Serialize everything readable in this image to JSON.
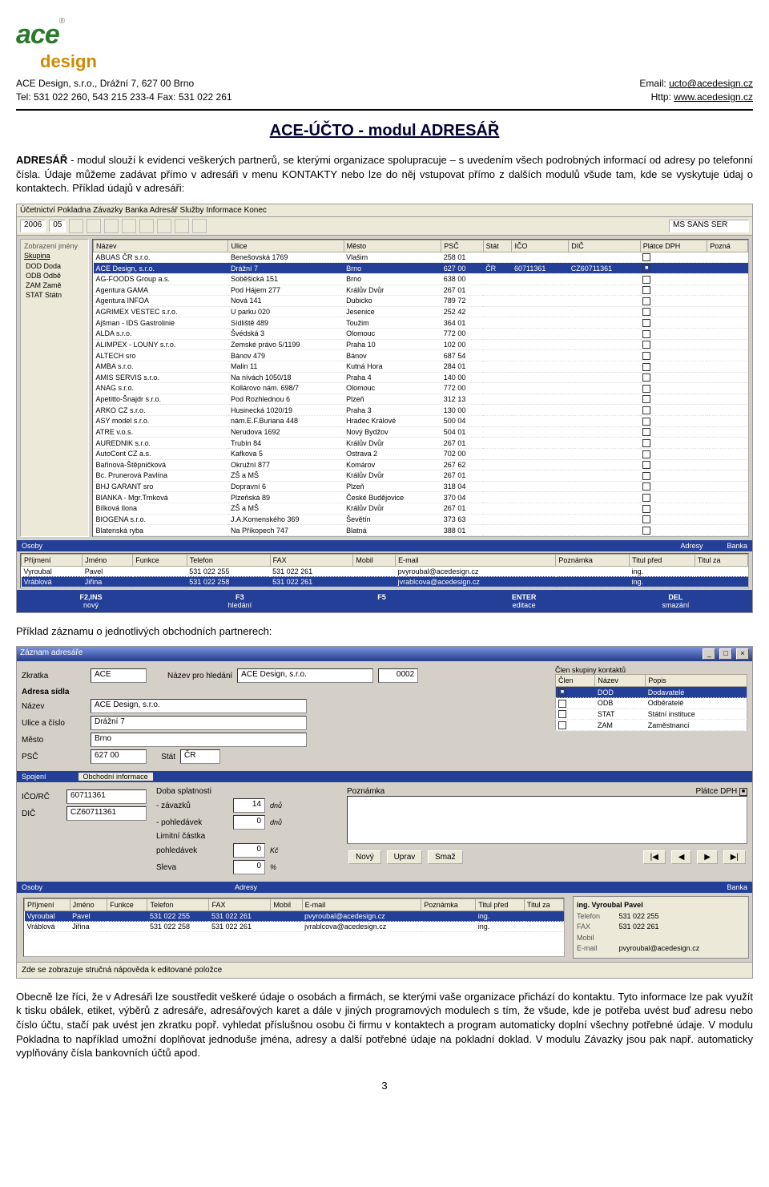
{
  "header": {
    "company": "ACE Design, s.r.o., Drážní 7, 627 00 Brno",
    "phone": "Tel: 531 022 260, 543 215 233-4   Fax: 531 022 261",
    "email_label": "Email: ",
    "email": "ucto@acedesign.cz",
    "web_label": "Http: ",
    "web": "www.acedesign.cz",
    "logo_text": "ace",
    "logo_sub": "design"
  },
  "title": "ACE-ÚČTO - modul ADRESÁŘ",
  "intro_bold": "ADRESÁŘ",
  "intro": " - modul slouží k evidenci veškerých partnerů, se kterými organizace spolupracuje – s uvedením všech podrobných informací od adresy po telefonní čísla. Údaje můžeme zadávat přímo v adresáři v menu KONTAKTY nebo lze do něj vstupovat přímo z dalších modulů všude tam, kde se vyskytuje údaj o kontaktech. Příklad údajů v adresáři:",
  "caption2": "Příklad záznamu o jednotlivých obchodních partnerech:",
  "outro": "Obecně lze říci, že v Adresáři lze soustředit veškeré údaje o osobách a firmách, se kterými vaše organizace přichází do kontaktu. Tyto informace lze pak využít k tisku obálek, etiket, výběrů z adresáře, adresářových karet a dále v jiných programových modulech s tím, že všude, kde je potřeba uvést buď adresu nebo číslo účtu, stačí pak uvést jen zkratku popř. vyhledat příslušnou osobu či firmu v kontaktech a program automaticky doplní všechny potřebné údaje. V modulu Pokladna to například umožní doplňovat jednoduše jména, adresy a další potřebné údaje na pokladní doklad. V modulu Závazky jsou pak např. automaticky vyplňovány čísla bankovních účtů apod.",
  "page_number": "3",
  "window1": {
    "title": "Účetnictví  Pokladna  Závazky  Banka  Adresář  Služby  Informace  Konec",
    "toolbar_year": "2006",
    "toolbar_month": "05",
    "font_label": "MS SANS SER",
    "sidebar_groups_header": "Skupina",
    "sidebar_groups": [
      {
        "code": "DOD",
        "desc": "Doda"
      },
      {
        "code": "ODB",
        "desc": "Odbě"
      },
      {
        "code": "ZAM",
        "desc": "Zamě"
      },
      {
        "code": "STAT",
        "desc": "Státn"
      }
    ],
    "zobrazeni": "Zobrazení jmény",
    "columns": [
      "Název",
      "Ulice",
      "Město",
      "PSČ",
      "Stát",
      "IČO",
      "DIČ",
      "Plátce DPH",
      "Pozná"
    ],
    "rows": [
      {
        "nazev": "ABUAS ČR s.r.o.",
        "ulice": "Benešovská 1769",
        "mesto": "Vlašim",
        "psc": "258 01",
        "stat": "",
        "ico": "",
        "dic": "",
        "dph": false,
        "sel": false
      },
      {
        "nazev": "ACE Design, s.r.o.",
        "ulice": "Drážní 7",
        "mesto": "Brno",
        "psc": "627 00",
        "stat": "ČR",
        "ico": "60711361",
        "dic": "CZ60711361",
        "dph": true,
        "sel": true
      },
      {
        "nazev": "AG-FOODS Group a.s.",
        "ulice": "Soběšická 151",
        "mesto": "Brno",
        "psc": "638 00",
        "stat": "",
        "ico": "",
        "dic": "",
        "dph": false,
        "sel": false
      },
      {
        "nazev": "Agentura GAMA",
        "ulice": "Pod Hájem 277",
        "mesto": "Králův Dvůr",
        "psc": "267 01",
        "stat": "",
        "ico": "",
        "dic": "",
        "dph": false,
        "sel": false
      },
      {
        "nazev": "Agentura INFOA",
        "ulice": "Nová 141",
        "mesto": "Dubicko",
        "psc": "789 72",
        "stat": "",
        "ico": "",
        "dic": "",
        "dph": false,
        "sel": false
      },
      {
        "nazev": "AGRIMEX VESTEC s.r.o.",
        "ulice": "U parku 020",
        "mesto": "Jesenice",
        "psc": "252 42",
        "stat": "",
        "ico": "",
        "dic": "",
        "dph": false,
        "sel": false
      },
      {
        "nazev": "Ajšman - IDS Gastrolinie",
        "ulice": "Sídliště 489",
        "mesto": "Toužim",
        "psc": "364 01",
        "stat": "",
        "ico": "",
        "dic": "",
        "dph": false,
        "sel": false
      },
      {
        "nazev": "ALDA s.r.o.",
        "ulice": "Švédská 3",
        "mesto": "Olomouc",
        "psc": "772 00",
        "stat": "",
        "ico": "",
        "dic": "",
        "dph": false,
        "sel": false
      },
      {
        "nazev": "ALIMPEX - LOUNY s.r.o.",
        "ulice": "Zemské právo 5/1199",
        "mesto": "Praha 10",
        "psc": "102 00",
        "stat": "",
        "ico": "",
        "dic": "",
        "dph": false,
        "sel": false
      },
      {
        "nazev": "ALTECH sro",
        "ulice": "Bánov 479",
        "mesto": "Bánov",
        "psc": "687 54",
        "stat": "",
        "ico": "",
        "dic": "",
        "dph": false,
        "sel": false
      },
      {
        "nazev": "AMBA s.r.o.",
        "ulice": "Malin 11",
        "mesto": "Kutná Hora",
        "psc": "284 01",
        "stat": "",
        "ico": "",
        "dic": "",
        "dph": false,
        "sel": false
      },
      {
        "nazev": "AMIS SERVIS s.r.o.",
        "ulice": "Na nívách 1050/18",
        "mesto": "Praha 4",
        "psc": "140 00",
        "stat": "",
        "ico": "",
        "dic": "",
        "dph": false,
        "sel": false
      },
      {
        "nazev": "ANAG s.r.o.",
        "ulice": "Kollárovo nám. 698/7",
        "mesto": "Olomouc",
        "psc": "772 00",
        "stat": "",
        "ico": "",
        "dic": "",
        "dph": false,
        "sel": false
      },
      {
        "nazev": "Apetitto-Šnajdr s.r.o.",
        "ulice": "Pod Rozhlednou 6",
        "mesto": "Plzeň",
        "psc": "312 13",
        "stat": "",
        "ico": "",
        "dic": "",
        "dph": false,
        "sel": false
      },
      {
        "nazev": "ARKO CZ s.r.o.",
        "ulice": "Husinecká 1020/19",
        "mesto": "Praha 3",
        "psc": "130 00",
        "stat": "",
        "ico": "",
        "dic": "",
        "dph": false,
        "sel": false
      },
      {
        "nazev": "ASY model s.r.o.",
        "ulice": "nám.E.F.Buriana 448",
        "mesto": "Hradec Králové",
        "psc": "500 04",
        "stat": "",
        "ico": "",
        "dic": "",
        "dph": false,
        "sel": false
      },
      {
        "nazev": "ATRE v.o.s.",
        "ulice": "Nerudova 1692",
        "mesto": "Nový Bydžov",
        "psc": "504 01",
        "stat": "",
        "ico": "",
        "dic": "",
        "dph": false,
        "sel": false
      },
      {
        "nazev": "AUREDNIK s.r.o.",
        "ulice": "Trubín 84",
        "mesto": "Králův Dvůr",
        "psc": "267 01",
        "stat": "",
        "ico": "",
        "dic": "",
        "dph": false,
        "sel": false
      },
      {
        "nazev": "AutoCont CZ a.s.",
        "ulice": "Kafkova 5",
        "mesto": "Ostrava 2",
        "psc": "702 00",
        "stat": "",
        "ico": "",
        "dic": "",
        "dph": false,
        "sel": false
      },
      {
        "nazev": "Bařinová-Štěpničková",
        "ulice": "Okružní 877",
        "mesto": "Komárov",
        "psc": "267 62",
        "stat": "",
        "ico": "",
        "dic": "",
        "dph": false,
        "sel": false
      },
      {
        "nazev": "Bc. Prunerová Pavlína",
        "ulice": "ZŠ a MŠ",
        "mesto": "Králův Dvůr",
        "psc": "267 01",
        "stat": "",
        "ico": "",
        "dic": "",
        "dph": false,
        "sel": false
      },
      {
        "nazev": "BHJ GARANT sro",
        "ulice": "Dopravní 6",
        "mesto": "Plzeň",
        "psc": "318 04",
        "stat": "",
        "ico": "",
        "dic": "",
        "dph": false,
        "sel": false
      },
      {
        "nazev": "BIANKA - Mgr.Trnková",
        "ulice": "Plzeňská 89",
        "mesto": "České Budějovice",
        "psc": "370 04",
        "stat": "",
        "ico": "",
        "dic": "",
        "dph": false,
        "sel": false
      },
      {
        "nazev": "Bílková Ilona",
        "ulice": "ZŠ a MŠ",
        "mesto": "Králův Dvůr",
        "psc": "267 01",
        "stat": "",
        "ico": "",
        "dic": "",
        "dph": false,
        "sel": false
      },
      {
        "nazev": "BIOGENA s.r.o.",
        "ulice": "J.A.Komenského 369",
        "mesto": "Ševětín",
        "psc": "373 63",
        "stat": "",
        "ico": "",
        "dic": "",
        "dph": false,
        "sel": false
      },
      {
        "nazev": "Blatenská ryba",
        "ulice": "Na Příkopech 747",
        "mesto": "Blatná",
        "psc": "388 01",
        "stat": "",
        "ico": "",
        "dic": "",
        "dph": false,
        "sel": false
      }
    ],
    "osoby_header": "Osoby",
    "adresy_header": "Adresy",
    "banka_header": "Banka",
    "osoby_cols": [
      "Příjmení",
      "Jméno",
      "Funkce",
      "Telefon",
      "FAX",
      "Mobil",
      "E-mail",
      "Poznámka",
      "Titul před",
      "Titul za"
    ],
    "osoby_rows": [
      {
        "prij": "Vyroubal",
        "jm": "Pavel",
        "fun": "",
        "tel": "531 022 255",
        "fax": "531 022 261",
        "mob": "",
        "email": "pvyroubal@acedesign.cz",
        "pozn": "",
        "tp": "ing.",
        "tz": ""
      },
      {
        "prij": "Vráblová",
        "jm": "Jiřina",
        "fun": "",
        "tel": "531 022 258",
        "fax": "531 022 261",
        "mob": "",
        "email": "jvrablcova@acedesign.cz",
        "pozn": "",
        "tp": "ing.",
        "tz": "",
        "sel": true
      }
    ],
    "fkeys": [
      {
        "k": "F2,INS",
        "t": "nový"
      },
      {
        "k": "F3",
        "t": "hledání"
      },
      {
        "k": "F5",
        "t": ""
      },
      {
        "k": "ENTER",
        "t": "editace"
      },
      {
        "k": "DEL",
        "t": "smazání"
      }
    ]
  },
  "window2": {
    "titlebar": "Záznam adresáře",
    "zkratka_label": "Zkratka",
    "zkratka": "ACE",
    "nazev_hledani_label": "Název pro hledání",
    "nazev_hledani": "ACE Design, s.r.o.",
    "cislo": "0002",
    "clen_label": "Člen skupiny kontaktů",
    "grp_cols": [
      "Člen",
      "Název",
      "Popis"
    ],
    "grp_rows": [
      {
        "c": true,
        "n": "DOD",
        "p": "Dodavatelé",
        "sel": true
      },
      {
        "c": false,
        "n": "ODB",
        "p": "Odběratelé"
      },
      {
        "c": false,
        "n": "STAT",
        "p": "Státní instituce"
      },
      {
        "c": false,
        "n": "ZAM",
        "p": "Zaměstnanci"
      }
    ],
    "adresa_sidla_label": "Adresa sídla",
    "nazev_label": "Název",
    "nazev": "ACE Design, s.r.o.",
    "ulice_label": "Ulice a číslo",
    "ulice": "Drážní 7",
    "mesto_label": "Město",
    "mesto": "Brno",
    "psc_label": "PSČ",
    "psc": "627 00",
    "stat_label": "Stát",
    "stat": "ČR",
    "spojeni_tab": "Spojení",
    "obch_tab": "Obchodní informace",
    "ico_label": "IČO/RČ",
    "ico": "60711361",
    "dic_label": "DIČ",
    "dic": "CZ60711361",
    "doba_label": "Doba splatnosti",
    "zav_label": "- závazků",
    "zav_val": "14",
    "zav_unit": "dnů",
    "pohl_label": "- pohledávek",
    "pohl_val": "0",
    "pohl_unit": "dnů",
    "lim_label": "Limitní částka",
    "lim_sub": "pohledávek",
    "lim_val": "0",
    "lim_unit": "Kč",
    "sleva_label": "Sleva",
    "sleva_val": "0",
    "sleva_unit": "%",
    "poznamka_label": "Poznámka",
    "platce_label": "Plátce DPH",
    "btn_novy": "Nový",
    "btn_uprav": "Uprav",
    "btn_smaz": "Smaž",
    "osoby_tab": "Osoby",
    "adresy_tab": "Adresy",
    "banka_tab": "Banka",
    "osoby2_cols": [
      "Příjmení",
      "Jméno",
      "Funkce",
      "Telefon",
      "FAX",
      "Mobil",
      "E-mail",
      "Poznámka",
      "Titul před",
      "Titul za"
    ],
    "osoby2_rows": [
      {
        "prij": "Vyroubal",
        "jm": "Pavel",
        "tel": "531 022 255",
        "fax": "531 022 261",
        "email": "pvyroubal@acedesign.cz",
        "tp": "ing.",
        "sel": true
      },
      {
        "prij": "Vráblová",
        "jm": "Jiřina",
        "tel": "531 022 258",
        "fax": "531 022 261",
        "email": "jvrablcova@acedesign.cz",
        "tp": "ing."
      }
    ],
    "card_name": "ing. Vyroubal Pavel",
    "card_fields": [
      {
        "l": "Telefon",
        "v": "531 022 255"
      },
      {
        "l": "FAX",
        "v": "531 022 261"
      },
      {
        "l": "Mobil",
        "v": ""
      },
      {
        "l": "E-mail",
        "v": "pvyroubal@acedesign.cz"
      }
    ],
    "statusbar": "Zde se zobrazuje stručná nápověda k editované položce"
  }
}
